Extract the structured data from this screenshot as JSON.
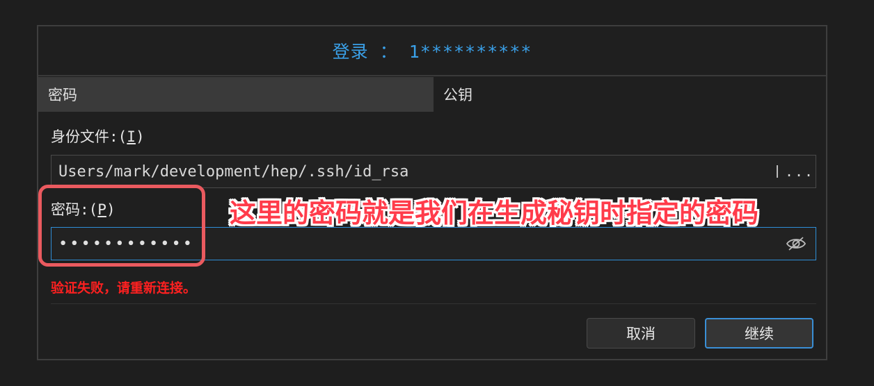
{
  "dialog": {
    "title": "登录 ： 1**********"
  },
  "tabs": [
    {
      "label": "密码",
      "active": true
    },
    {
      "label": "公钥",
      "active": false
    }
  ],
  "identity_file": {
    "label_prefix": "身份文件:(",
    "label_key": "I",
    "label_suffix": ")",
    "value": "Users/mark/development/hep/.ssh/id_rsa",
    "browse_label": "..."
  },
  "password": {
    "label_prefix": "密码:(",
    "label_key": "P",
    "label_suffix": ")",
    "masked_value": "••••••••••••",
    "toggle_icon": "eye-slash-icon"
  },
  "error_message": "验证失败，请重新连接。",
  "buttons": {
    "cancel": "取消",
    "continue": "继续"
  },
  "annotation": {
    "text": "这里的密码就是我们在生成秘钥时指定的密码",
    "color": "#ff3b4a"
  },
  "colors": {
    "accent": "#3aa0e8",
    "error": "#ff2020",
    "highlight": "#ea5a5f"
  }
}
